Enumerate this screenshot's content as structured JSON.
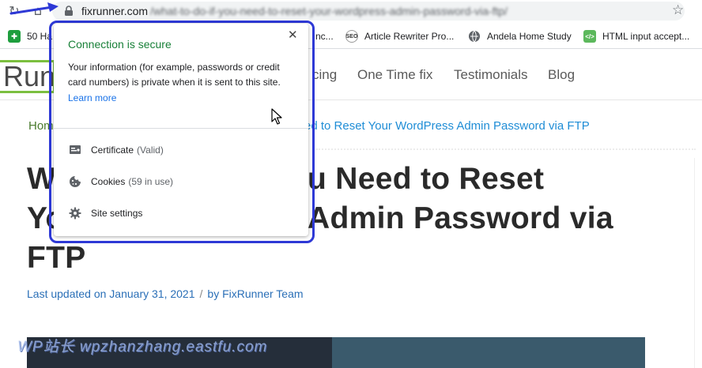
{
  "browser": {
    "url_host": "fixrunner.com",
    "url_path": "/what-to-do-if-you-need-to-reset-your-wordpress-admin-password-via-ftp/"
  },
  "bookmarks": [
    {
      "label": "50 Ha",
      "icon": "puzzle-icon",
      "color": "#1e9e3e"
    },
    {
      "label": "nc...",
      "icon": "globe-icon",
      "color": "#5f6368"
    },
    {
      "label": "Article Rewriter Pro...",
      "icon": "seo-icon",
      "color": "#ffffff"
    },
    {
      "label": "Andela Home Study",
      "icon": "globe-icon",
      "color": "#5f6368"
    },
    {
      "label": "HTML input accept...",
      "icon": "code-icon",
      "color": "#5cb85c"
    }
  ],
  "site": {
    "logo_text": "Run",
    "menu": [
      "cing",
      "One Time fix",
      "Testimonials",
      "Blog"
    ],
    "breadcrumb_home": "Hom",
    "breadcrumb_current": "ed to Reset Your WordPress Admin Password via FTP",
    "title_lines": [
      "W",
      "u Need to Reset",
      "Yo",
      "Admin Password via",
      "FTP"
    ],
    "meta_updated": "Last updated on January 31, 2021",
    "meta_separator": "/",
    "meta_author": "by FixRunner Team",
    "watermark": "WP站长 wpzhanzhang.eastfu.com",
    "hero_colors": {
      "left": "#252e3a",
      "right": "#3a5a6c"
    }
  },
  "popup": {
    "title": "Connection is secure",
    "description": "Your information (for example, passwords or credit card numbers) is private when it is sent to this site.",
    "learn_more": "Learn more",
    "rows": [
      {
        "label": "Certificate",
        "detail": "(Valid)",
        "icon": "certificate-icon"
      },
      {
        "label": "Cookies",
        "detail": "(59 in use)",
        "icon": "cookie-icon"
      },
      {
        "label": "Site settings",
        "detail": "",
        "icon": "gear-icon"
      }
    ],
    "close_symbol": "✕",
    "title_color": "#188038",
    "highlight_color": "#2e39d6"
  }
}
